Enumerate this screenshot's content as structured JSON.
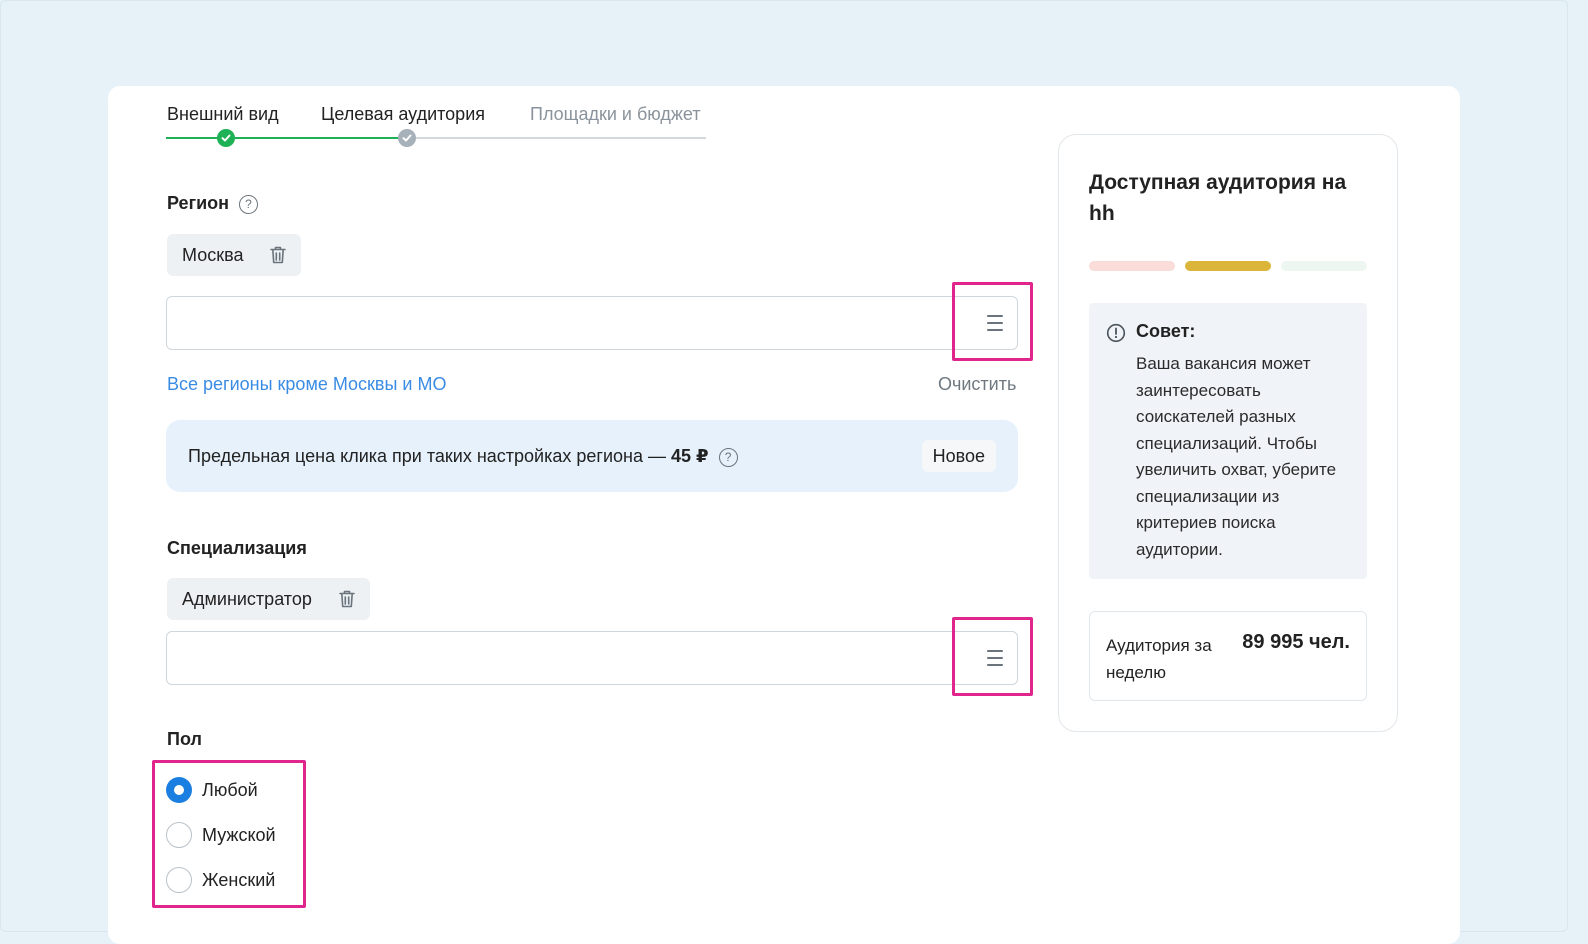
{
  "stepper": {
    "steps": [
      {
        "label": "Внешний вид",
        "state": "done"
      },
      {
        "label": "Целевая аудитория",
        "state": "current"
      },
      {
        "label": "Площадки и бюджет",
        "state": "future"
      }
    ]
  },
  "region": {
    "title": "Регион",
    "help": "?",
    "chip": "Москва",
    "input_value": "",
    "link": "Все регионы кроме Москвы и МО",
    "clear": "Очистить"
  },
  "banner": {
    "text": "Предельная цена клика при таких настройках региона — ",
    "price": "45 ₽",
    "help": "?",
    "badge": "Новое"
  },
  "specialization": {
    "title": "Специализация",
    "chip": "Администратор",
    "input_value": ""
  },
  "gender": {
    "title": "Пол",
    "options": [
      {
        "label": "Любой",
        "checked": true
      },
      {
        "label": "Мужской",
        "checked": false
      },
      {
        "label": "Женский",
        "checked": false
      }
    ]
  },
  "sidebar": {
    "title": "Доступная аудитория на hh",
    "meter_colors": [
      "#fadcd9",
      "#dbb53a",
      "#eef6f1"
    ],
    "tip": {
      "icon": "!",
      "title": "Совет:",
      "text": "Ваша вакансия может заинтересовать соискателей разных специализаций. Чтобы увеличить охват, уберите специализации из критериев поиска аудитории."
    },
    "audience": {
      "label": "Аудитория за неделю",
      "value": "89 995 чел."
    }
  },
  "colors": {
    "accent_green": "#1fb155",
    "accent_blue": "#1a7fe0",
    "link_blue": "#3a8be3",
    "highlight": "#e0258c"
  }
}
